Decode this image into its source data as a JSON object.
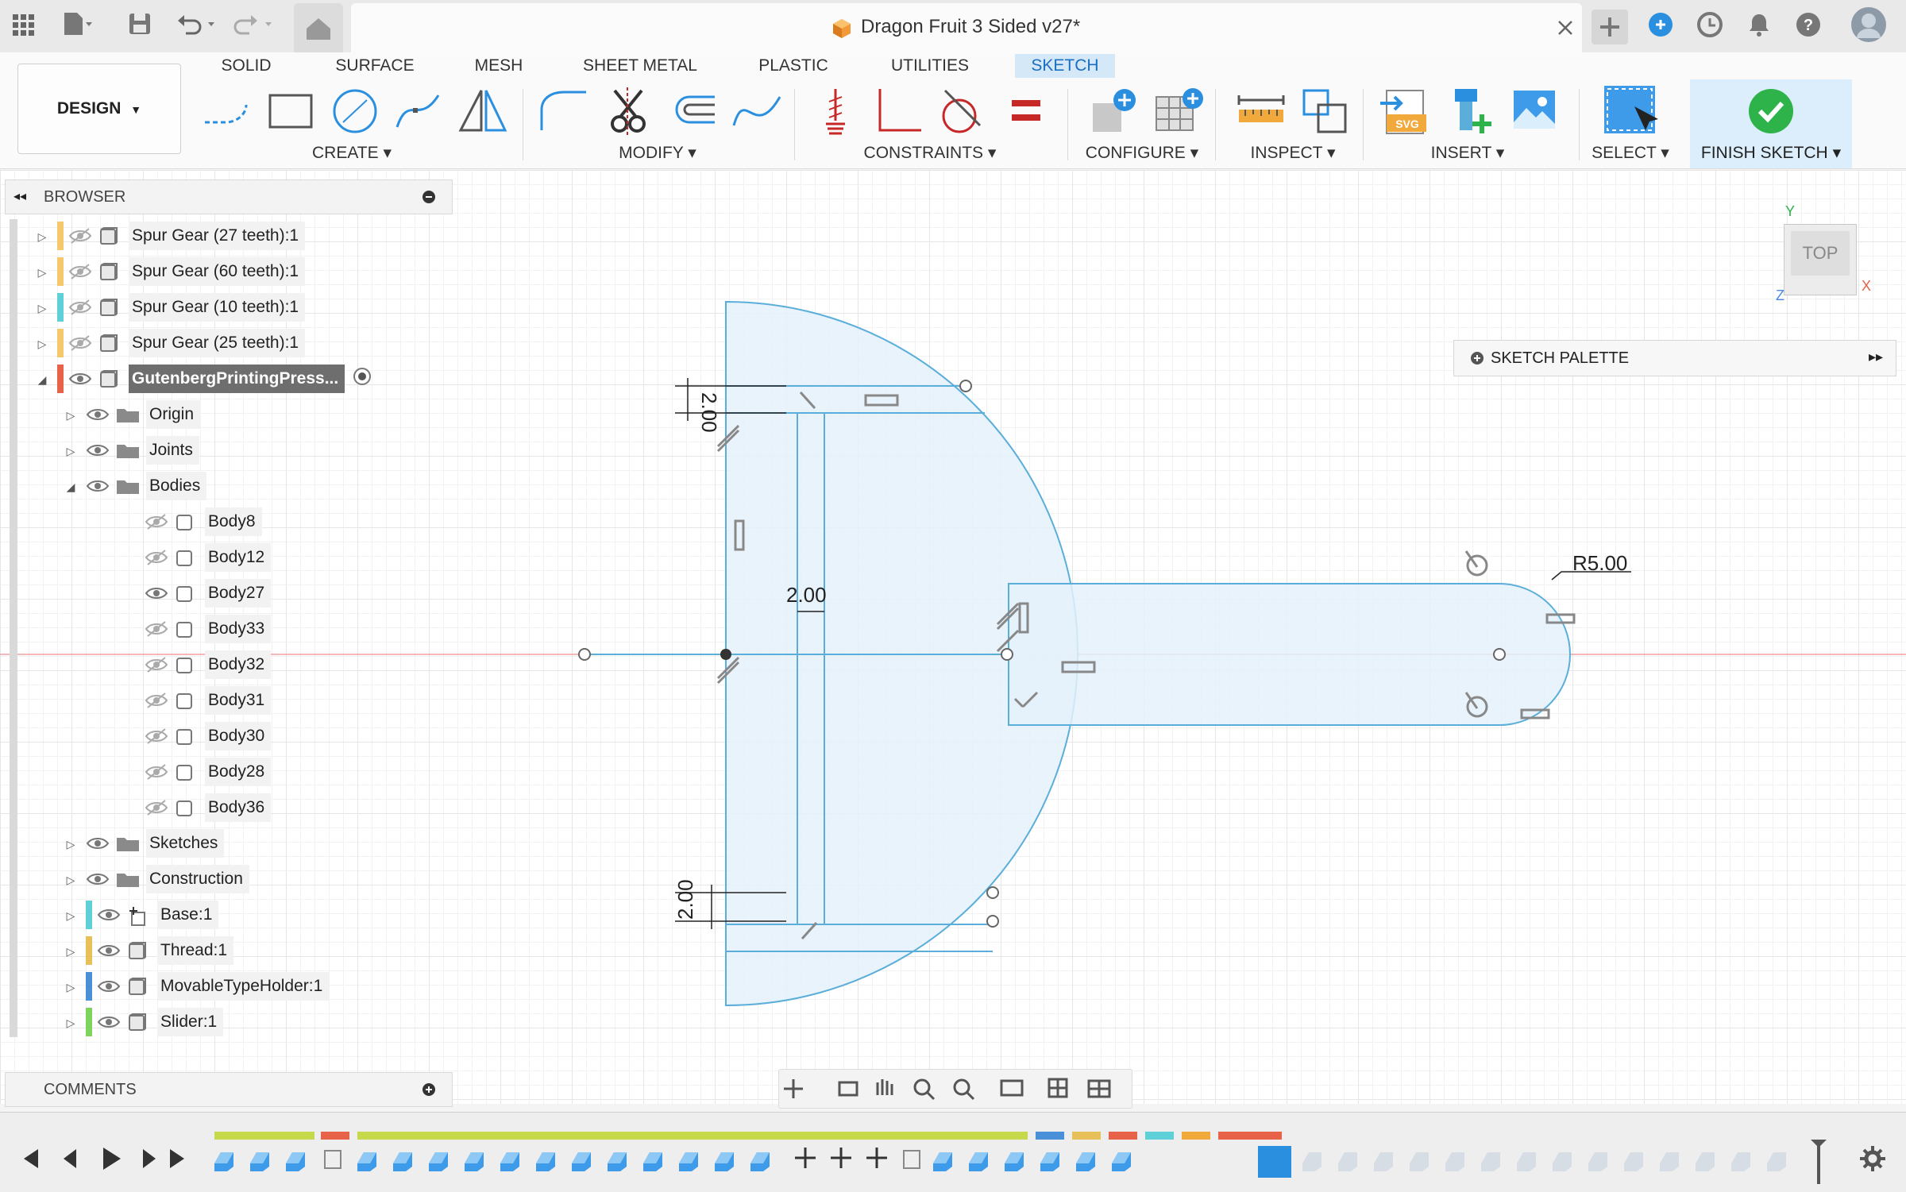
{
  "window": {
    "title": "Dragon Fruit 3 Sided v27*"
  },
  "workspace": {
    "label": "DESIGN"
  },
  "ribbon": {
    "tabs": [
      "SOLID",
      "SURFACE",
      "MESH",
      "SHEET METAL",
      "PLASTIC",
      "UTILITIES",
      "SKETCH"
    ],
    "active_tab": "SKETCH",
    "groups": [
      "CREATE",
      "MODIFY",
      "CONSTRAINTS",
      "CONFIGURE",
      "INSPECT",
      "INSERT",
      "SELECT",
      "FINISH SKETCH"
    ]
  },
  "browser": {
    "title": "BROWSER",
    "rows": [
      {
        "label": "Spur Gear (27 teeth):1",
        "color": "#f5c86b"
      },
      {
        "label": "Spur Gear (60 teeth):1",
        "color": "#f5c86b"
      },
      {
        "label": "Spur Gear (10 teeth):1",
        "color": "#5fd0d8"
      },
      {
        "label": "Spur Gear (25 teeth):1",
        "color": "#f5c86b"
      },
      {
        "label": "GutenbergPrintingPress...",
        "color": "#e8624a"
      },
      {
        "label": "Origin"
      },
      {
        "label": "Joints"
      },
      {
        "label": "Bodies"
      },
      {
        "label": "Body8"
      },
      {
        "label": "Body12"
      },
      {
        "label": "Body27"
      },
      {
        "label": "Body33"
      },
      {
        "label": "Body32"
      },
      {
        "label": "Body31"
      },
      {
        "label": "Body30"
      },
      {
        "label": "Body28"
      },
      {
        "label": "Body36"
      },
      {
        "label": "Sketches"
      },
      {
        "label": "Construction"
      },
      {
        "label": "Base:1",
        "color": "#5fd0d8"
      },
      {
        "label": "Thread:1",
        "color": "#e8c05a"
      },
      {
        "label": "MovableTypeHolder:1",
        "color": "#4a90d9"
      },
      {
        "label": "Slider:1",
        "color": "#7dd35b"
      }
    ]
  },
  "comments": {
    "title": "COMMENTS"
  },
  "palette": {
    "title": "SKETCH PALETTE"
  },
  "viewcube": {
    "face": "TOP",
    "axis_x": "X",
    "axis_y": "Y",
    "axis_z": "Z"
  },
  "dimensions": {
    "top": "2.00",
    "middle": "2.00",
    "bottom": "2.00",
    "radius": "R5.00"
  },
  "colors": {
    "accent": "#1a6fc0",
    "sketch_fill": "#e4f1fa",
    "sketch_line": "#5aaed9",
    "finish_green": "#2db34a"
  }
}
